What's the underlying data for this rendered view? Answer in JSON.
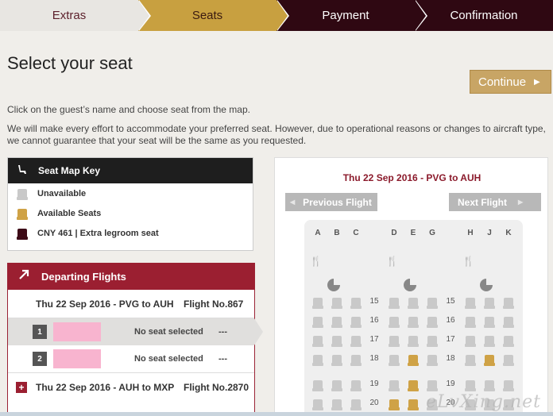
{
  "steps": [
    {
      "label": "Extras",
      "state": "done"
    },
    {
      "label": "Seats",
      "state": "active"
    },
    {
      "label": "Payment",
      "state": "todo"
    },
    {
      "label": "Confirmation",
      "state": "todo"
    }
  ],
  "page_title": "Select your seat",
  "continue_label": "Continue",
  "intro": [
    "Click on the guest’s name and choose seat from the map.",
    "We will make every effort to accommodate your preferred seat. However, due to operational reasons or changes to aircraft type, we cannot guarantee that your seat will be the same as you requested."
  ],
  "seat_key": {
    "title": "Seat Map Key",
    "items": [
      {
        "label": "Unavailable",
        "color": "#c9c9c9"
      },
      {
        "label": "Available Seats",
        "color": "#cfa246"
      },
      {
        "label": "CNY 461 | Extra legroom seat",
        "color": "#3d0b17"
      }
    ]
  },
  "departing": {
    "title": "Departing Flights",
    "flights": [
      {
        "route": "Thu 22 Sep 2016 - PVG to AUH",
        "number": "Flight No.867"
      },
      {
        "route": "Thu 22 Sep 2016 - AUH to MXP",
        "number": "Flight No.2870"
      }
    ],
    "passengers": [
      {
        "num": "1",
        "status": "No seat selected",
        "seat": "---"
      },
      {
        "num": "2",
        "status": "No seat selected",
        "seat": "---"
      }
    ]
  },
  "seatmap": {
    "title": "Thu 22 Sep 2016 - PVG to AUH",
    "prev_label": "Previous Flight",
    "next_label": "Next Flight",
    "columns": [
      "A",
      "B",
      "C",
      "D",
      "E",
      "G",
      "H",
      "J",
      "K"
    ],
    "rows": [
      "15",
      "16",
      "17",
      "18",
      "19",
      "20"
    ],
    "watermark": "eLvXing.net"
  },
  "colors": {
    "brand": "#9b1f31",
    "gold": "#c8a040",
    "dark": "#3d0b17"
  }
}
